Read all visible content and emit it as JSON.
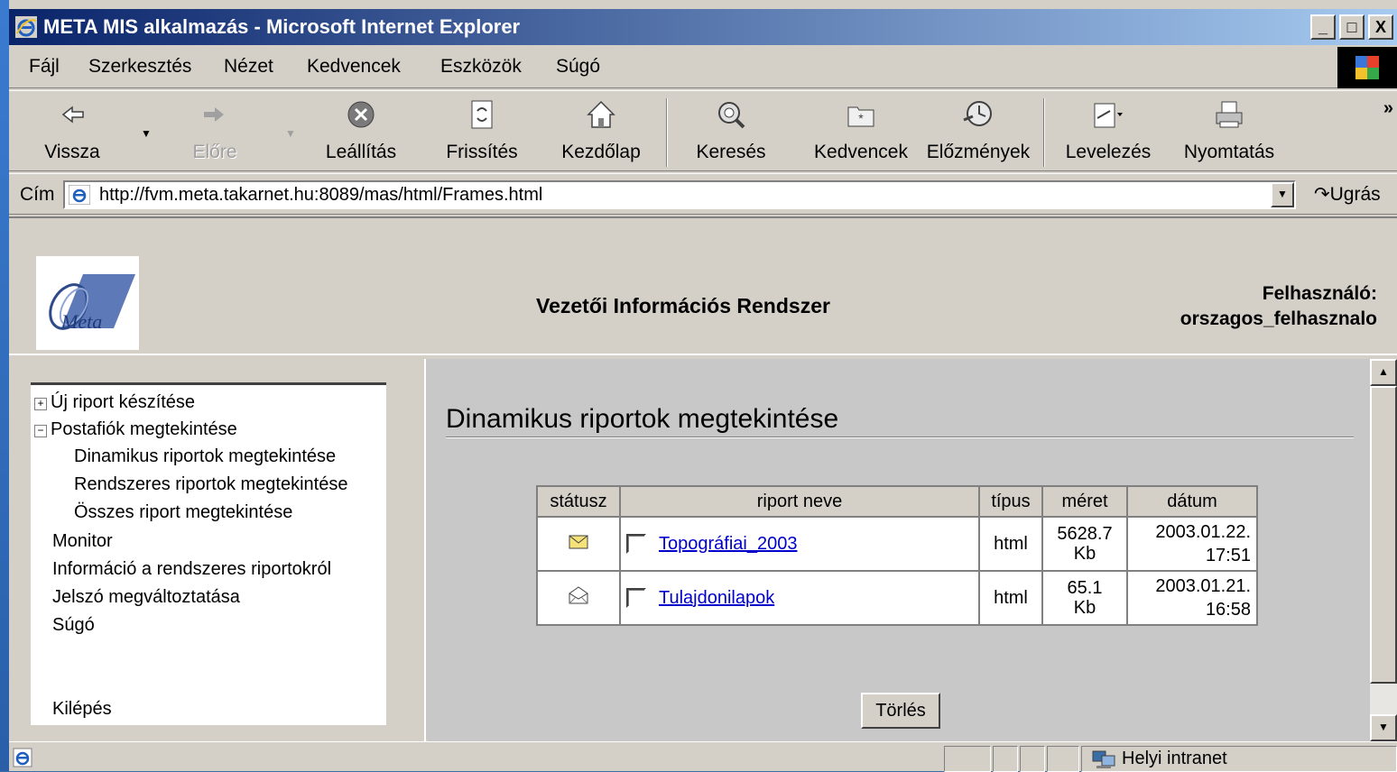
{
  "window": {
    "title": "META MIS alkalmazás - Microsoft Internet Explorer",
    "controls": [
      "_",
      "□",
      "X"
    ]
  },
  "menubar": {
    "items": [
      {
        "label": "Fájl"
      },
      {
        "label": "Szerkesztés"
      },
      {
        "label": "Nézet"
      },
      {
        "label": "Kedvencek"
      },
      {
        "label": "Eszközök"
      },
      {
        "label": "Súgó"
      }
    ]
  },
  "toolbar": {
    "back": {
      "label": "Vissza",
      "icon": "back-arrow-icon"
    },
    "forward": {
      "label": "Előre",
      "icon": "forward-arrow-icon"
    },
    "stop": {
      "label": "Leállítás",
      "icon": "stop-icon"
    },
    "refresh": {
      "label": "Frissítés",
      "icon": "refresh-icon"
    },
    "home": {
      "label": "Kezdőlap",
      "icon": "home-icon"
    },
    "search": {
      "label": "Keresés",
      "icon": "search-icon"
    },
    "favorites": {
      "label": "Kedvencek",
      "icon": "favorites-icon"
    },
    "history": {
      "label": "Előzmények",
      "icon": "history-icon"
    },
    "mail": {
      "label": "Levelezés",
      "icon": "mail-icon"
    },
    "print": {
      "label": "Nyomtatás",
      "icon": "print-icon"
    },
    "more": "»"
  },
  "address": {
    "label": "Cím",
    "url": "http://fvm.meta.takarnet.hu:8089/mas/html/Frames.html",
    "go_label": "Ugrás"
  },
  "header": {
    "logo_text": "Meta",
    "app_title": "Vezetői Információs Rendszer",
    "user_label": "Felhasználó:",
    "user_name": "orszagos_felhasznalo"
  },
  "tree": {
    "items": [
      {
        "label": "Új riport készítése",
        "toggle": "+"
      },
      {
        "label": "Postafiók megtekintése",
        "toggle": "−"
      },
      {
        "label": "Dinamikus riportok megtekintése"
      },
      {
        "label": "Rendszeres riportok megtekintése"
      },
      {
        "label": "Összes riport megtekintése"
      },
      {
        "label": "Monitor"
      },
      {
        "label": "Információ a rendszeres riportokról"
      },
      {
        "label": "Jelszó megváltoztatása"
      },
      {
        "label": "Súgó"
      },
      {
        "label": "Kilépés"
      }
    ]
  },
  "content": {
    "title": "Dinamikus riportok megtekintése",
    "table": {
      "headers": [
        "státusz",
        "riport neve",
        "típus",
        "méret",
        "dátum"
      ],
      "rows": [
        {
          "status_icon": "unread-envelope-icon",
          "name": "Topográfiai_2003",
          "type": "html",
          "size_value": "5628.7",
          "size_unit": "Kb",
          "date": "2003.01.22.",
          "time": "17:51"
        },
        {
          "status_icon": "read-envelope-icon",
          "name": "Tulajdonilapok",
          "type": "html",
          "size_value": "65.1",
          "size_unit": "Kb",
          "date": "2003.01.21.",
          "time": "16:58"
        }
      ]
    },
    "delete_label": "Törlés"
  },
  "statusbar": {
    "zone": "Helyi intranet"
  },
  "colors": {
    "titlebar_start": "#0a246a",
    "titlebar_end": "#a6caf0",
    "chrome": "#d4d0c8",
    "link": "#0000cc"
  }
}
